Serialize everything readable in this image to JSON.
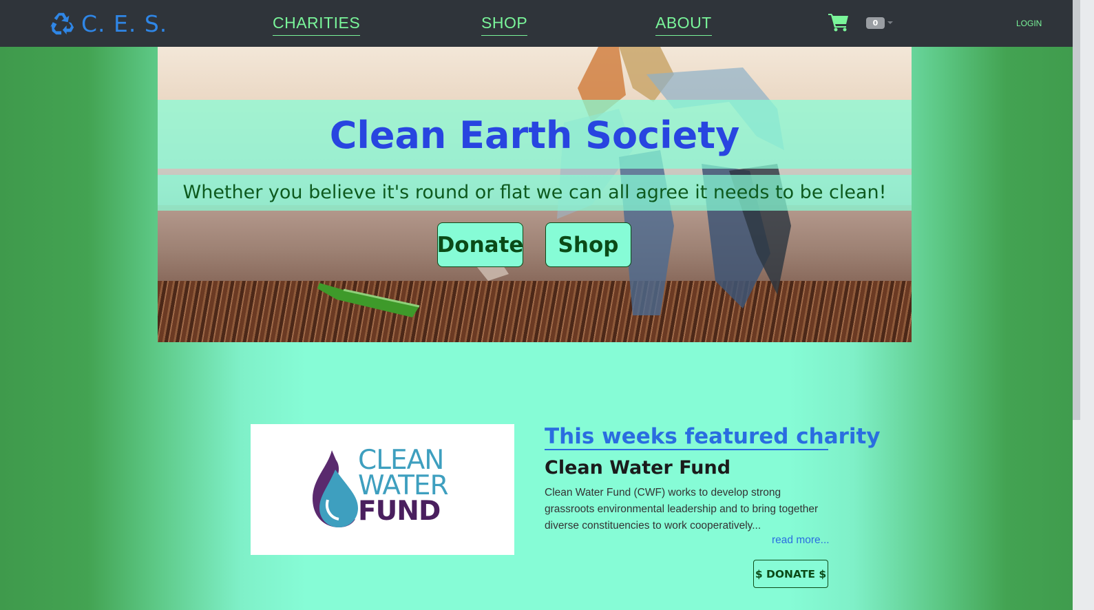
{
  "navbar": {
    "brand": "C. E. S.",
    "links": [
      "CHARITIES",
      "SHOP",
      "ABOUT"
    ],
    "cart_count": "0",
    "login": "LOGIN"
  },
  "hero": {
    "title": "Clean Earth Society",
    "subtitle": "Whether you believe it's round or flat we can all agree it needs to be clean!",
    "donate_label": "Donate",
    "shop_label": "Shop"
  },
  "featured": {
    "heading": "This weeks featured charity",
    "name": "Clean Water Fund",
    "description": "Clean Water Fund (CWF) works to develop strong grassroots environmental leadership and to bring together diverse constituencies to work cooperatively...",
    "read_more": "read more...",
    "donate_label": "$ DONATE $",
    "logo_lines": [
      "CLEAN",
      "WATER",
      "FUND"
    ]
  },
  "colors": {
    "navbar_bg": "#2f343a",
    "brand": "#2f86e6",
    "nav_link": "#7af59a",
    "mint": "#86fcd6",
    "title_blue": "#2845e0",
    "dark_green": "#0b4a17"
  },
  "icons": [
    "recycle-icon",
    "shopping-cart-icon",
    "chevron-down-icon",
    "water-drop-icon"
  ]
}
